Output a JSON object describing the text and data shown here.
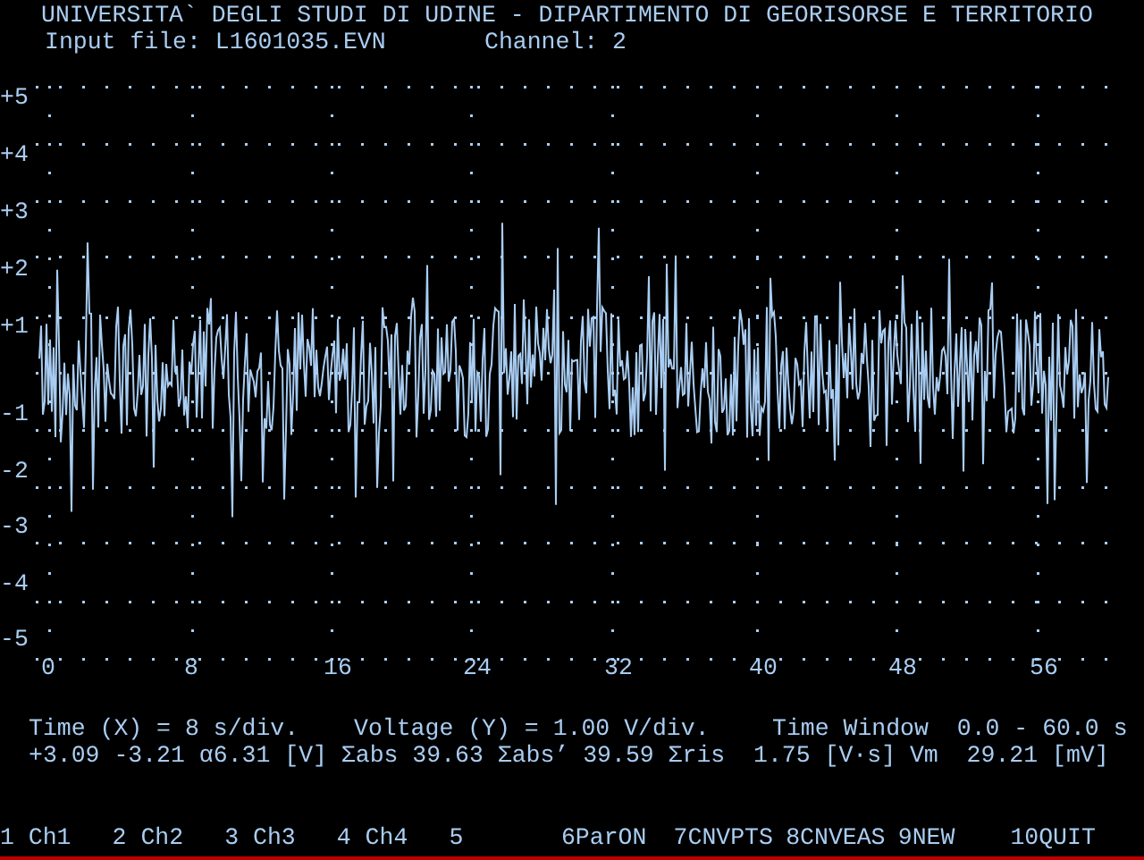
{
  "header": {
    "title": "UNIVERSITA` DEGLI STUDI DI UDINE - DIPARTIMENTO DI GEORISORSE E TERRITORIO",
    "input_file": "Input file: L1601035.EVN",
    "channel": "Channel: 2"
  },
  "plot": {
    "y_labels": [
      "+5",
      "+4",
      "+3",
      "+2",
      "+1",
      "-1",
      "-2",
      "-3",
      "-4",
      "-5"
    ],
    "x_labels": [
      "0",
      "8",
      "16",
      "24",
      "32",
      "40",
      "48",
      "56"
    ]
  },
  "info": {
    "time_scale": "Time (X) = 8 s/div.",
    "voltage_scale": "Voltage (Y) = 1.00 V/div.",
    "time_window": "Time Window  0.0 - 60.0 s",
    "stats": "+3.09 -3.21 α6.31 [V] Σabs 39.63 Σabs’ 39.59 Σris  1.75 [V·s] Vm  29.21 [mV]"
  },
  "menu": [
    "1 Ch1",
    "2 Ch2",
    "3 Ch3",
    "4 Ch4",
    "5",
    "6ParON",
    "7CNVPTS",
    "8CNVEAS",
    "9NEW",
    "10QUIT"
  ]
}
